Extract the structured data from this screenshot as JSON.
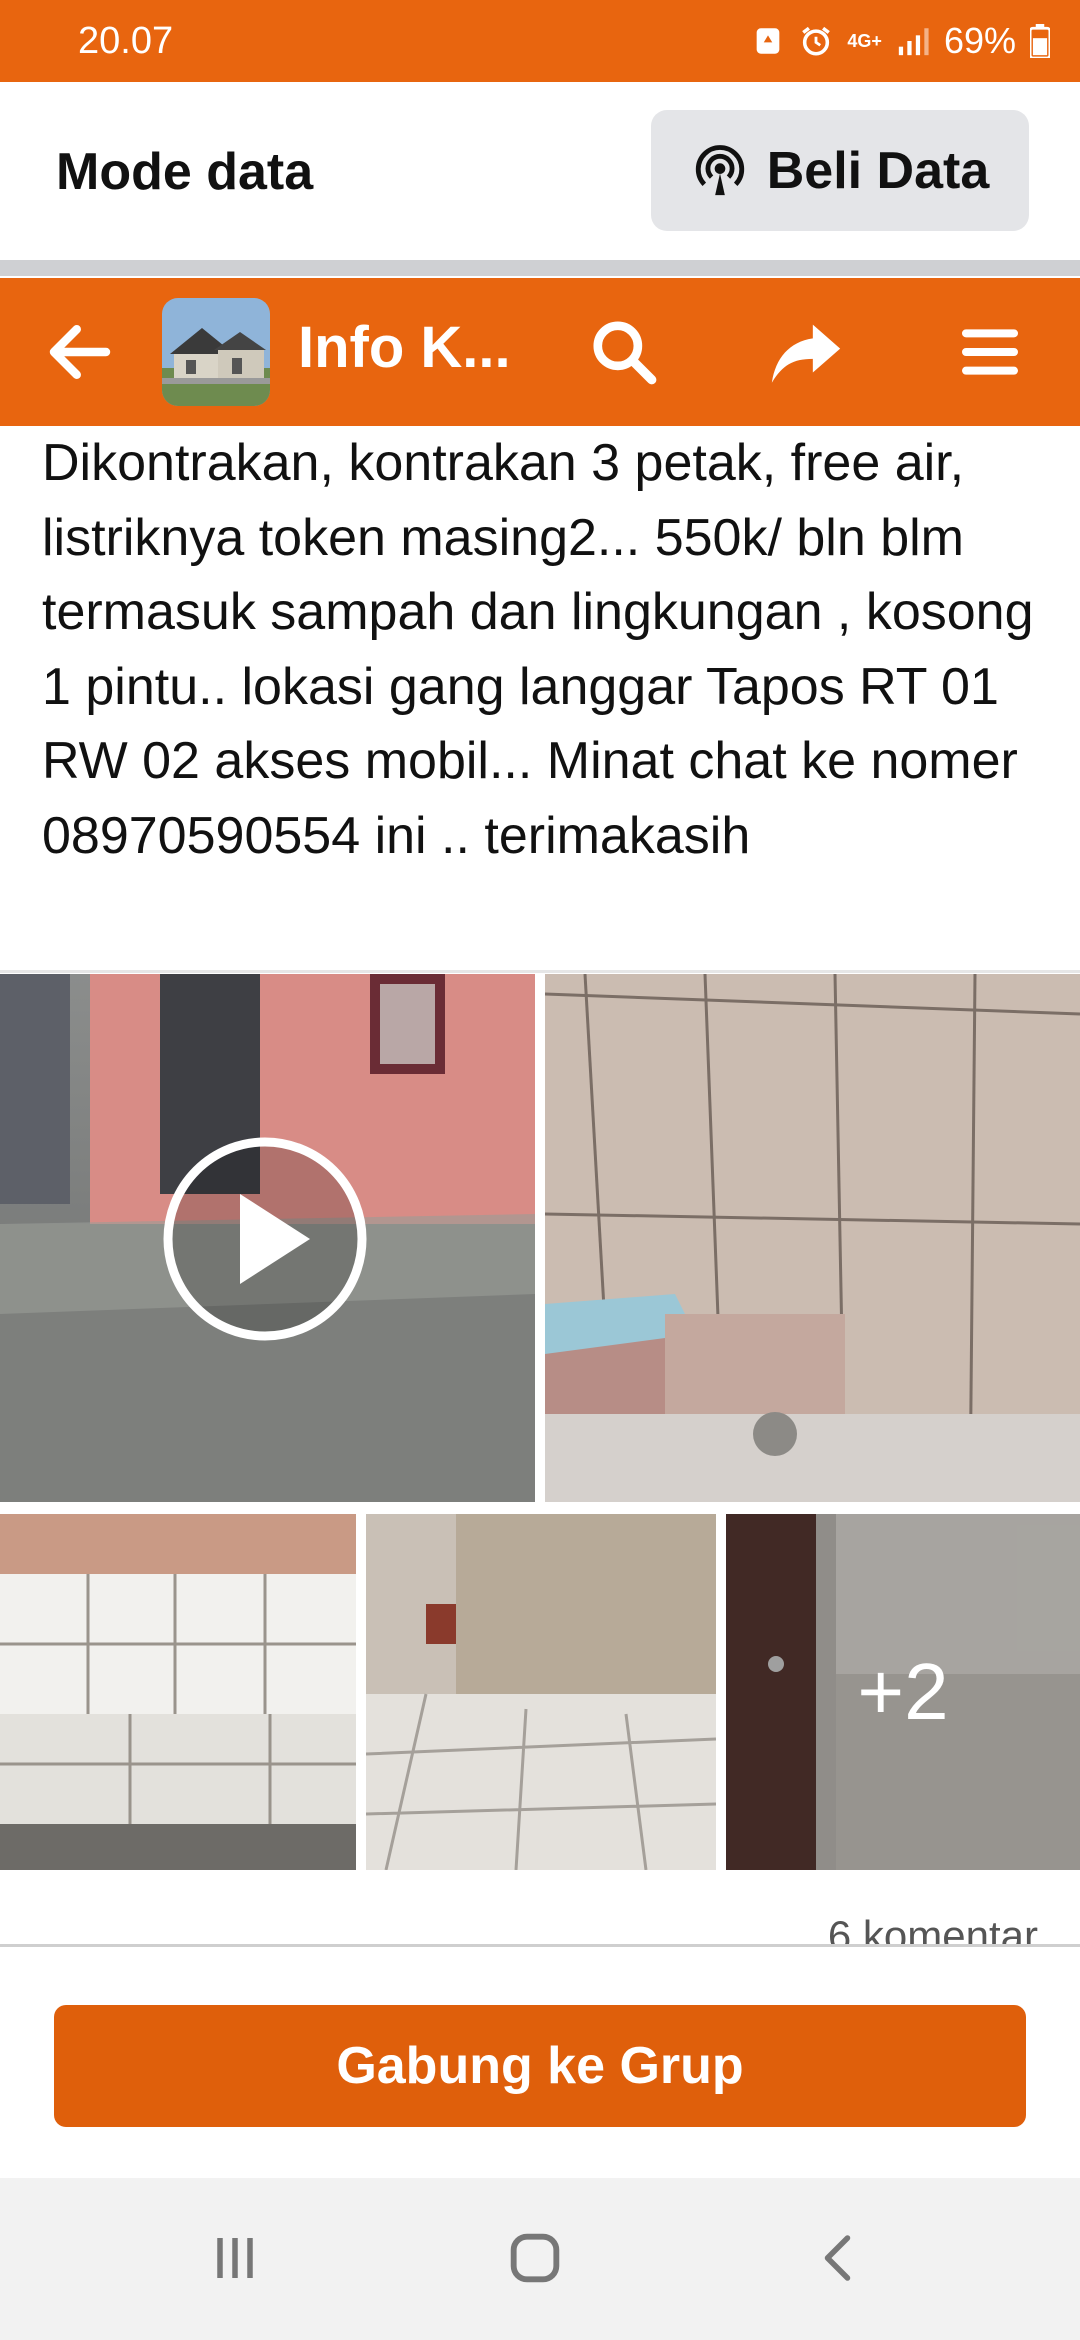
{
  "status_bar": {
    "time": "20.07",
    "network": "4G+",
    "battery": "69%",
    "icons": [
      "recycle-icon",
      "alarm-icon",
      "network-4g-icon",
      "signal-icon",
      "battery-icon"
    ]
  },
  "data_banner": {
    "mode_label": "Mode data",
    "buy_label": "Beli Data",
    "buy_icon": "broadcast-icon"
  },
  "header": {
    "title": "Info K...",
    "icons": [
      "back-arrow-icon",
      "search-icon",
      "share-icon",
      "menu-icon"
    ]
  },
  "post": {
    "text": "Dikontrakan, kontrakan 3 petak, free air, listriknya token masing2... 550k/ bln blm termasuk sampah dan lingkungan , kosong 1 pintu.. lokasi gang langgar Tapos RT 01 RW 02 akses mobil... Minat chat ke nomer 08970590554 ini .. terimakasih",
    "media_more": "+2",
    "comments": "6 komentar"
  },
  "footer": {
    "join_label": "Gabung ke Grup"
  },
  "colors": {
    "brand_orange": "#e8650f",
    "button_orange": "#df5f0b"
  }
}
